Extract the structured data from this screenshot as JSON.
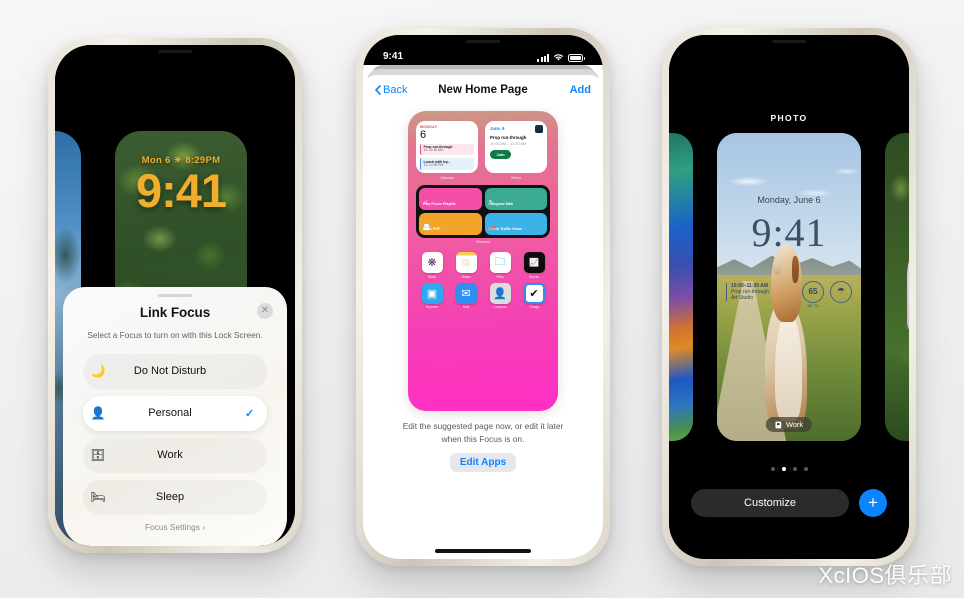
{
  "watermark": "XcIOS俱乐部",
  "phone1": {
    "lock_screen": {
      "date": "Mon 6  ☀ 8:29PM",
      "time": "9:41"
    },
    "sheet": {
      "title": "Link Focus",
      "close_label": "✕",
      "subtitle": "Select a Focus to turn on with this Lock Screen.",
      "options": [
        {
          "label": "Do Not Disturb",
          "icon": "moon-icon",
          "glyph": "🌙",
          "selected": false
        },
        {
          "label": "Personal",
          "icon": "person-icon",
          "glyph": "👤",
          "selected": true
        },
        {
          "label": "Work",
          "icon": "briefcase-icon",
          "glyph": "🗄",
          "selected": false
        },
        {
          "label": "Sleep",
          "icon": "bed-icon",
          "glyph": "🛏",
          "selected": false
        }
      ],
      "check_glyph": "✓",
      "footer": "Focus Settings ›"
    }
  },
  "phone2": {
    "status_bar": {
      "time": "9:41"
    },
    "nav": {
      "back": "Back",
      "title": "New Home Page",
      "add": "Add"
    },
    "home_preview": {
      "calendar_widget": {
        "day_name": "MONDAY",
        "day_num": "6",
        "events": [
          {
            "title": "Prop run-through",
            "time": "10–11:30 AM",
            "color": "pink"
          },
          {
            "title": "Lunch with Ivy...",
            "time": "12–12:30 PM",
            "color": "blue"
          }
        ],
        "label": "Calendar"
      },
      "webex_widget": {
        "date": "June, 6",
        "title": "Prop run-through",
        "time": "10:00 AM – 11:30 AM",
        "button": "Join",
        "label": "Webex"
      },
      "shortcuts": {
        "label": "Shortcuts",
        "items": [
          {
            "name": "Play Focus Playlist",
            "glyph": "♫",
            "color": "#f54ea8"
          },
          {
            "name": "Compose Mail",
            "glyph": "✎",
            "color": "#3bab93"
          },
          {
            "name": "Make PDF",
            "glyph": "📄",
            "color": "#f3a52b"
          },
          {
            "name": "Check Traffic Home",
            "glyph": "🚗",
            "color": "#3cb3e8"
          }
        ]
      },
      "apps": [
        {
          "name": "Slack",
          "glyph": "❋",
          "bg": "#ffffff",
          "fg": "#611f69"
        },
        {
          "name": "Notes",
          "glyph": "▤",
          "bg": "#fdfdfd",
          "fg": "#f0b323"
        },
        {
          "name": "Files",
          "glyph": "🗀",
          "bg": "#2e9ff0",
          "fg": "#ffffff"
        },
        {
          "name": "Stocks",
          "glyph": "📈",
          "bg": "#111111",
          "fg": "#4ade80"
        },
        {
          "name": "Keynote",
          "glyph": "▣",
          "bg": "#2ea8f0",
          "fg": "#ffffff"
        },
        {
          "name": "Mail",
          "glyph": "✉",
          "bg": "#2e8ff0",
          "fg": "#ffffff"
        },
        {
          "name": "Contacts",
          "glyph": "👤",
          "bg": "#d8d8d8",
          "fg": "#8a8a8a"
        },
        {
          "name": "Things",
          "glyph": "✔",
          "bg": "#ffffff",
          "fg": "#1a1a1a"
        }
      ]
    },
    "footer_text": "Edit the suggested page now, or edit it later when this Focus is on.",
    "edit_apps_button": "Edit Apps"
  },
  "phone3": {
    "section_label": "PHOTO",
    "lock_screen": {
      "date": "Monday, June 6",
      "time": "9:41",
      "event": {
        "time": "10:00–11:30 AM",
        "title": "Prop run-through",
        "place": "Art Studio"
      },
      "temperature": "65",
      "temp_lo": "55",
      "temp_hi": "72",
      "rain_icon": "umbrella-icon",
      "rain_glyph": "☂",
      "focus_badge": "Work"
    },
    "page_dots": {
      "count": 4,
      "active_index": 1
    },
    "customize_button": "Customize",
    "add_button": "+"
  },
  "colors": {
    "ios_blue": "#0a84ff",
    "lock_amber": "#f0ae2e",
    "join_green": "#0e7a46",
    "dark_pill": "#2b2b2d"
  }
}
